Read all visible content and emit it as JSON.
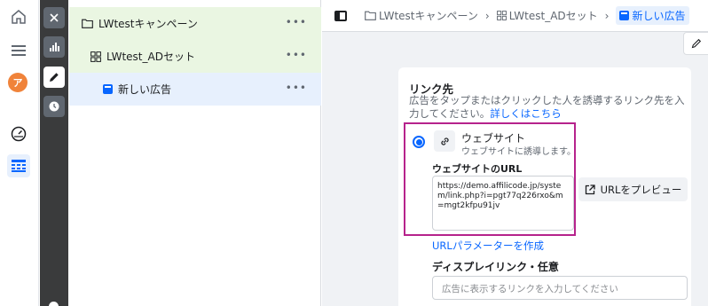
{
  "rail": {
    "avatar_letter": "ア"
  },
  "tree": {
    "campaign_label": "LWtestキャンペーン",
    "adset_label": "LWtest_ADセット",
    "ad_label": "新しい広告",
    "more": "•••"
  },
  "breadcrumb": {
    "campaign": "LWtestキャンペーン",
    "adset": "LWtest_ADセット",
    "ad": "新しい広告",
    "separator": "›"
  },
  "destination": {
    "title": "リンク先",
    "description": "広告をタップまたはクリックした人を誘導するリンク先を入力してください。",
    "learn_more": "詳しくはこちら",
    "option_title": "ウェブサイト",
    "option_subtitle": "ウェブサイトに誘導します。",
    "url_label": "ウェブサイトのURL",
    "url_value": "https://demo.affilicode.jp/system/link.php?i=pgt77q226rxo&m=mgt2kfpu91jv",
    "preview_button": "URLをプレビュー",
    "param_link": "URLパラメーターを作成",
    "display_link_label": "ディスプレイリンク・任意",
    "display_link_placeholder": "広告に表示するリンクを入力してください"
  },
  "colors": {
    "accent": "#0866ff",
    "highlight": "#b6238c",
    "tree_green": "#eaf6e2",
    "tree_blue": "#e7f0fd",
    "strip": "#3a3b3c"
  }
}
